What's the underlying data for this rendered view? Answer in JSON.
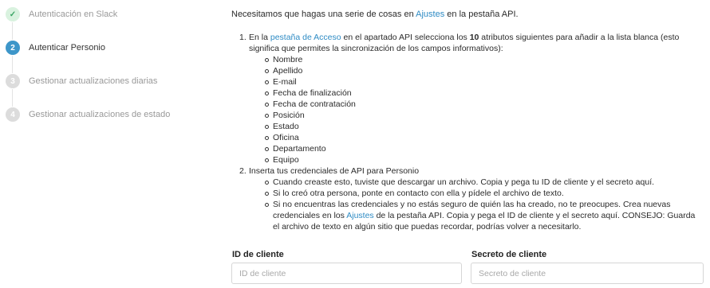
{
  "steps": [
    {
      "number": "✓",
      "label": "Autenticación en Slack",
      "state": "done"
    },
    {
      "number": "2",
      "label": "Autenticar Personio",
      "state": "active"
    },
    {
      "number": "3",
      "label": "Gestionar actualizaciones diarias",
      "state": "todo"
    },
    {
      "number": "4",
      "label": "Gestionar actualizaciones de estado",
      "state": "todo"
    }
  ],
  "intro": {
    "before": "Necesitamos que hagas una serie de cosas en ",
    "link": "Ajustes",
    "after": " en la pestaña API."
  },
  "item1": {
    "number": "1.",
    "text_a": "En la ",
    "link": "pestaña de Acceso",
    "text_b": " en el apartado API selecciona los ",
    "count": "10",
    "text_c": " atributos siguientes para añadir a la lista blanca (esto significa que permites la sincronización de los campos informativos):",
    "attributes": [
      "Nombre",
      "Apellido",
      "E-mail",
      "Fecha de finalización",
      "Fecha de contratación",
      "Posición",
      "Estado",
      "Oficina",
      "Departamento",
      "Equipo"
    ]
  },
  "item2": {
    "number": "2.",
    "text": "Inserta tus credenciales de API para Personio",
    "bullet1": "Cuando creaste esto, tuviste que descargar un archivo. Copia y pega tu ID de cliente y el secreto aquí.",
    "bullet2": "Si lo creó otra persona, ponte en contacto con ella y pídele el archivo de texto.",
    "bullet3_a": "Si no encuentras las credenciales y no estás seguro de quién las ha creado, no te preocupes. Crea nuevas credenciales en los ",
    "bullet3_link": "Ajustes",
    "bullet3_b": " de la pestaña API. Copia y pega el ID de cliente y el secreto aquí. CONSEJO: Guarda el archivo de texto en algún sitio que puedas recordar, podrías volver a necesitarlo."
  },
  "fields": {
    "client_id_label": "ID de cliente",
    "client_id_placeholder": "ID de cliente",
    "client_id_value": "",
    "secret_label": "Secreto de cliente",
    "secret_placeholder": "Secreto de cliente",
    "secret_value": ""
  },
  "colors": {
    "link": "#2e8bc4",
    "active_step": "#3d96c9",
    "done_step_bg": "#d9f2df",
    "done_step_fg": "#3aa564",
    "todo_step": "#dcdcdc"
  },
  "icons": {
    "done_step": "check-icon"
  }
}
